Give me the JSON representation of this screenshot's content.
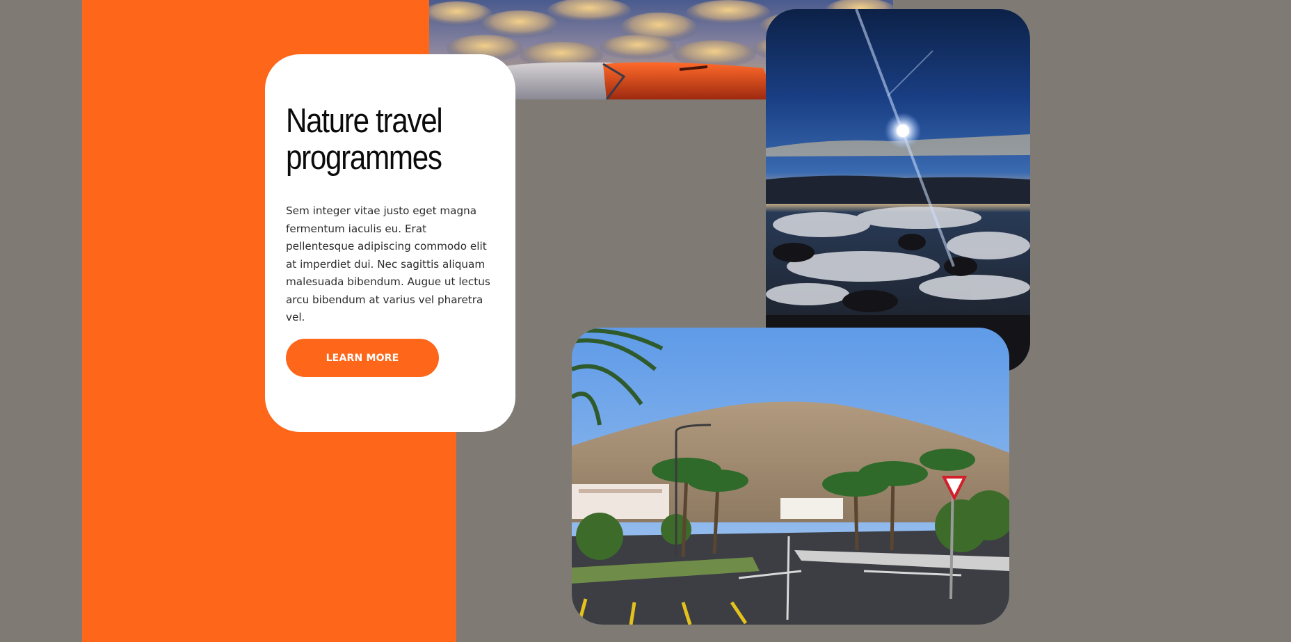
{
  "feature": {
    "title_line1": "Nature travel",
    "title_line2": "programmes",
    "body": "Sem integer vitae justo eget magna fermentum iaculis eu. Erat pellentesque adipiscing commodo elit at imperdiet dui. Nec sagittis aliquam malesuada bibendum. Augue ut lectus arcu bibendum at varius vel pharetra vel.",
    "button_label": "LEARN MORE"
  },
  "colors": {
    "accent": "#fe6619",
    "background": "#7f7b74",
    "card": "#ffffff"
  },
  "images": {
    "top": "airplane-wing-above-clouds-photo",
    "right": "sun-over-rocky-coast-photo",
    "bottom": "palm-lined-road-mountain-photo"
  }
}
